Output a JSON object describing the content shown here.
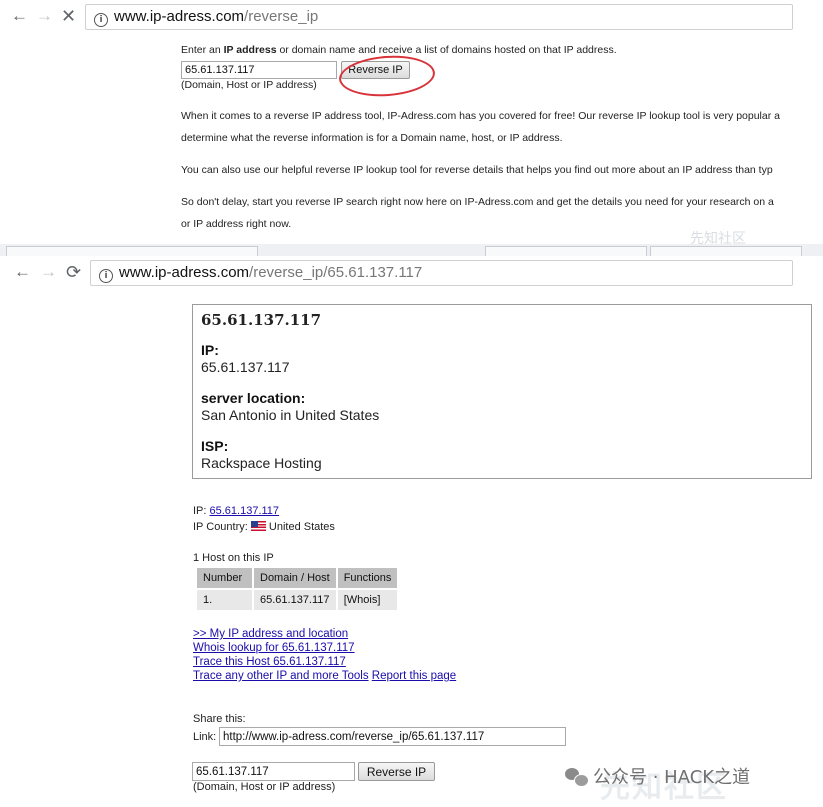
{
  "browser1": {
    "url_host": "www.ip-adress.com",
    "url_path": "/reverse_ip"
  },
  "form1": {
    "intro_prefix": "Enter an ",
    "intro_bold": "IP address",
    "intro_suffix": " or domain name and receive a list of domains hosted on that IP address.",
    "input_value": "65.61.137.117",
    "button_label": "Reverse IP",
    "hint": "(Domain, Host or IP address)"
  },
  "paragraphs": [
    "When it comes to a reverse IP address tool, IP-Adress.com has you covered for free! Our reverse IP lookup tool is very popular a",
    "determine what the reverse information is for a Domain name, host, or IP address.",
    "You can also use our helpful reverse IP lookup tool for reverse details that helps you find out more about an IP address than typ",
    "So don't delay, start you reverse IP search right now here on IP-Adress.com and get the details you need for your research on a",
    "or IP address right now."
  ],
  "browser2": {
    "url_host": "www.ip-adress.com",
    "url_path": "/reverse_ip/65.61.137.117"
  },
  "details": {
    "heading": "65.61.137.117",
    "ip_label": "IP:",
    "ip_value": "65.61.137.117",
    "location_label": "server location:",
    "location_value": "San Antonio in United States",
    "isp_label": "ISP:",
    "isp_value": "Rackspace Hosting"
  },
  "info": {
    "ip_prefix": "IP: ",
    "ip_link": "65.61.137.117",
    "country_prefix": "IP Country: ",
    "country": "United States",
    "hosts_count": "1 Host on this IP"
  },
  "host_table": {
    "headers": [
      "Number",
      "Domain / Host",
      "Functions"
    ],
    "rows": [
      [
        "1.",
        "65.61.137.117",
        "[Whois]"
      ]
    ]
  },
  "links": {
    "my_ip": ">> My IP address and location",
    "whois": "Whois lookup for 65.61.137.117",
    "trace_host": "Trace this Host 65.61.137.117",
    "trace_other": "Trace any other IP and more Tools",
    "report": "Report this page"
  },
  "share": {
    "title": "Share this:",
    "link_label": "Link:",
    "link_value": "http://www.ip-adress.com/reverse_ip/65.61.137.117"
  },
  "form2": {
    "input_value": "65.61.137.117",
    "button_label": "Reverse IP",
    "hint": "(Domain, Host or IP address)"
  },
  "watermark": {
    "top": "先知社区",
    "bottom": "先知社区",
    "wechat_text": "公众号 · HACK之道"
  },
  "icons": {
    "back": "arrow-left-icon",
    "forward": "arrow-right-icon",
    "stop": "close-icon",
    "reload": "reload-icon",
    "info": "info-icon",
    "flag": "us-flag-icon",
    "wechat": "wechat-icon"
  },
  "colors": {
    "link": "#1a0dab",
    "annotation": "#d8333a",
    "table_header": "#c0c0c0",
    "table_cell": "#e8e8e8"
  }
}
